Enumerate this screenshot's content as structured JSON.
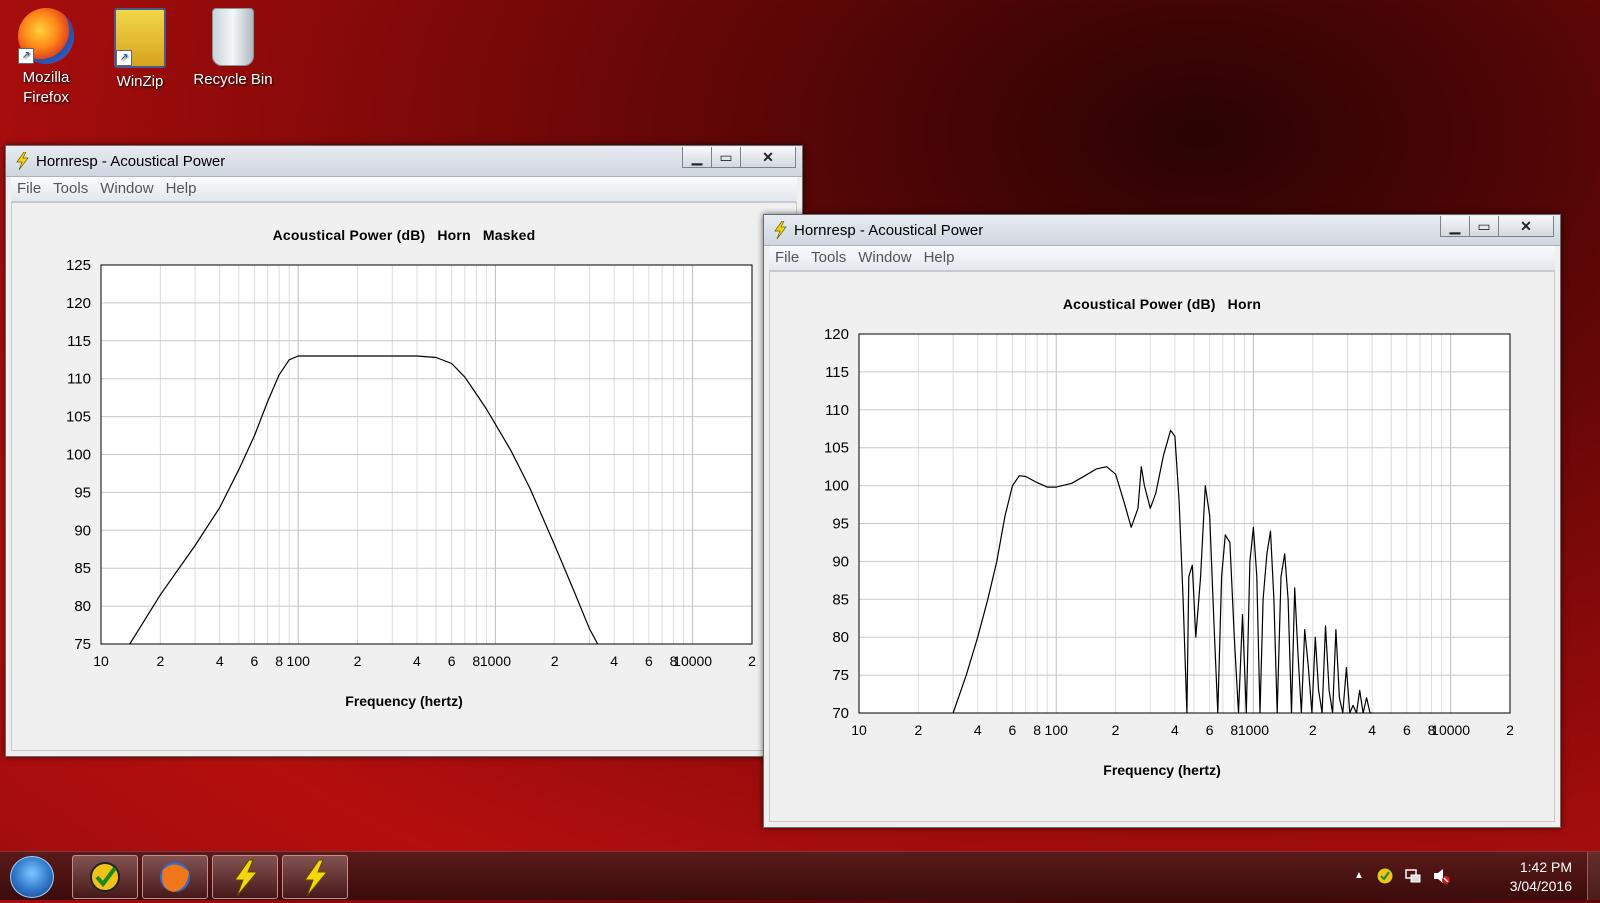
{
  "desktop": {
    "icons": [
      {
        "label_line1": "Mozilla",
        "label_line2": "Firefox"
      },
      {
        "label_line1": "WinZip",
        "label_line2": ""
      },
      {
        "label_line1": "Recycle Bin",
        "label_line2": ""
      }
    ]
  },
  "windows": [
    {
      "title": "Hornresp - Acoustical Power",
      "menu": [
        "File",
        "Tools",
        "Window",
        "Help"
      ],
      "plot_title": [
        "Acoustical Power (dB)",
        "Horn",
        "Masked"
      ],
      "xlabel": "Frequency (hertz)"
    },
    {
      "title": "Hornresp - Acoustical Power",
      "menu": [
        "File",
        "Tools",
        "Window",
        "Help"
      ],
      "plot_title": [
        "Acoustical Power (dB)",
        "Horn"
      ],
      "xlabel": "Frequency (hertz)"
    }
  ],
  "window_buttons": {
    "minimize": "▁",
    "maximize": "▭",
    "close": "✕"
  },
  "chart_data": [
    {
      "type": "line",
      "title": "Acoustical Power (dB)   Horn   Masked",
      "xlabel": "Frequency (hertz)",
      "ylabel": "",
      "x_scale": "log",
      "xlim": [
        10,
        20000
      ],
      "ylim": [
        75,
        125
      ],
      "y_ticks": [
        75,
        80,
        85,
        90,
        95,
        100,
        105,
        110,
        115,
        120,
        125
      ],
      "x_tick_labels": [
        {
          "value": 10,
          "label": "10"
        },
        {
          "value": 20,
          "label": "2"
        },
        {
          "value": 40,
          "label": "4"
        },
        {
          "value": 60,
          "label": "6"
        },
        {
          "value": 80,
          "label": "8"
        },
        {
          "value": 100,
          "label": "100"
        },
        {
          "value": 200,
          "label": "2"
        },
        {
          "value": 400,
          "label": "4"
        },
        {
          "value": 600,
          "label": "6"
        },
        {
          "value": 800,
          "label": "8"
        },
        {
          "value": 1000,
          "label": "1000"
        },
        {
          "value": 2000,
          "label": "2"
        },
        {
          "value": 4000,
          "label": "4"
        },
        {
          "value": 6000,
          "label": "6"
        },
        {
          "value": 8000,
          "label": "8"
        },
        {
          "value": 10000,
          "label": "10000"
        },
        {
          "value": 20000,
          "label": "2"
        }
      ],
      "grid": true,
      "series": [
        {
          "x": [
            14,
            20,
            30,
            40,
            50,
            60,
            70,
            80,
            90,
            100,
            150,
            200,
            300,
            400,
            500,
            600,
            700,
            800,
            900,
            1000,
            1200,
            1500,
            2000,
            2500,
            3000,
            3300
          ],
          "y": [
            75,
            81.5,
            88,
            93,
            98,
            102.5,
            107,
            110.5,
            112.5,
            113,
            113,
            113,
            113,
            113,
            112.8,
            112,
            110.2,
            108,
            106,
            104,
            100.5,
            95.5,
            88,
            82,
            77,
            75
          ]
        }
      ]
    },
    {
      "type": "line",
      "title": "Acoustical Power (dB)   Horn",
      "xlabel": "Frequency (hertz)",
      "ylabel": "",
      "x_scale": "log",
      "xlim": [
        10,
        20000
      ],
      "ylim": [
        70,
        120
      ],
      "y_ticks": [
        70,
        75,
        80,
        85,
        90,
        95,
        100,
        105,
        110,
        115,
        120
      ],
      "x_tick_labels": [
        {
          "value": 10,
          "label": "10"
        },
        {
          "value": 20,
          "label": "2"
        },
        {
          "value": 40,
          "label": "4"
        },
        {
          "value": 60,
          "label": "6"
        },
        {
          "value": 80,
          "label": "8"
        },
        {
          "value": 100,
          "label": "100"
        },
        {
          "value": 200,
          "label": "2"
        },
        {
          "value": 400,
          "label": "4"
        },
        {
          "value": 600,
          "label": "6"
        },
        {
          "value": 800,
          "label": "8"
        },
        {
          "value": 1000,
          "label": "1000"
        },
        {
          "value": 2000,
          "label": "2"
        },
        {
          "value": 4000,
          "label": "4"
        },
        {
          "value": 6000,
          "label": "6"
        },
        {
          "value": 8000,
          "label": "8"
        },
        {
          "value": 10000,
          "label": "10000"
        },
        {
          "value": 20000,
          "label": "2"
        }
      ],
      "grid": true,
      "series": [
        {
          "x": [
            30,
            35,
            40,
            45,
            50,
            55,
            60,
            65,
            70,
            80,
            90,
            100,
            120,
            140,
            160,
            180,
            200,
            220,
            240,
            260,
            270,
            280,
            300,
            320,
            350,
            380,
            400,
            420,
            440,
            460,
            470,
            490,
            510,
            540,
            570,
            600,
            630,
            660,
            690,
            720,
            760,
            800,
            840,
            880,
            920,
            960,
            1000,
            1040,
            1080,
            1120,
            1170,
            1220,
            1270,
            1320,
            1380,
            1440,
            1500,
            1560,
            1620,
            1680,
            1750,
            1820,
            1900,
            1980,
            2060,
            2140,
            2230,
            2320,
            2420,
            2520,
            2620,
            2730,
            2840,
            2960,
            3080,
            3200,
            3330,
            3460,
            3600,
            3750,
            3900,
            4000
          ],
          "y": [
            70,
            75,
            80,
            85,
            90,
            96,
            100,
            101.3,
            101.2,
            100.4,
            99.8,
            99.8,
            100.3,
            101.3,
            102.2,
            102.5,
            101.5,
            98,
            94.5,
            97,
            102.5,
            100,
            97,
            99,
            104,
            107.3,
            106.5,
            98,
            85,
            70,
            88,
            89.5,
            80,
            88,
            100,
            96,
            82,
            70,
            88,
            93.5,
            92.5,
            80,
            70,
            83,
            70,
            90,
            94.5,
            88,
            70,
            85,
            91,
            94,
            85,
            70,
            88,
            91,
            85,
            70,
            86.5,
            78,
            70,
            81,
            76,
            70,
            80,
            73,
            70,
            81.5,
            73,
            70,
            81,
            72,
            70,
            76,
            70,
            71,
            70,
            73,
            70,
            72,
            70,
            70
          ]
        }
      ]
    }
  ],
  "taskbar": {
    "clock_time": "1:42 PM",
    "clock_date": "3/04/2016",
    "tray_arrow": "▲"
  }
}
